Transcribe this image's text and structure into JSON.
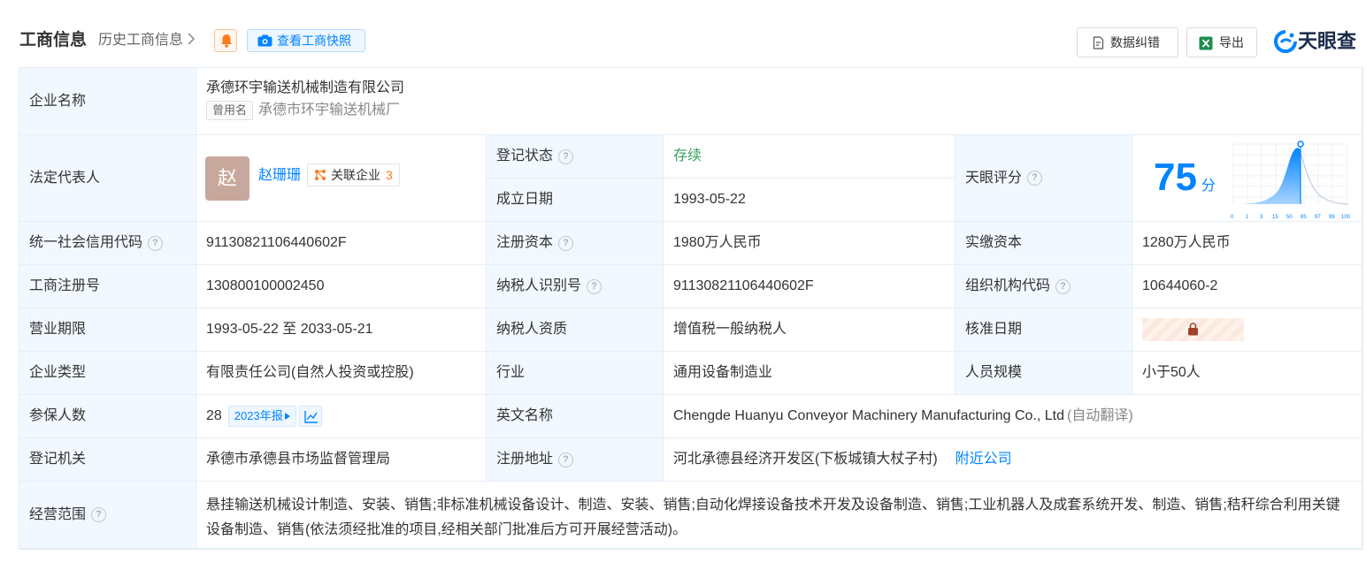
{
  "header": {
    "title": "工商信息",
    "history_link": "历史工商信息",
    "snapshot_button": "查看工商快照",
    "correct_button": "数据纠错",
    "export_button": "导出",
    "brand": "天眼查"
  },
  "company": {
    "name_label": "企业名称",
    "name": "承德环宇输送机械制造有限公司",
    "alias_tag": "曾用名",
    "alias": "承德市环宇输送机械厂",
    "legal_rep_label": "法定代表人",
    "legal_rep_avatar": "赵",
    "legal_rep_name": "赵珊珊",
    "related_label": "关联企业",
    "related_count": "3",
    "reg_status_label": "登记状态",
    "reg_status": "存续",
    "founded_label": "成立日期",
    "founded": "1993-05-22",
    "score_label": "天眼评分",
    "score": "75",
    "score_unit": "分",
    "score_ticks": [
      "0",
      "1",
      "3",
      "15",
      "50",
      "85",
      "97",
      "99",
      "100"
    ],
    "credit_code_label": "统一社会信用代码",
    "credit_code": "91130821106440602F",
    "reg_capital_label": "注册资本",
    "reg_capital": "1980万人民币",
    "paid_capital_label": "实缴资本",
    "paid_capital": "1280万人民币",
    "reg_no_label": "工商注册号",
    "reg_no": "130800100002450",
    "taxpayer_id_label": "纳税人识别号",
    "taxpayer_id": "91130821106440602F",
    "org_code_label": "组织机构代码",
    "org_code": "10644060-2",
    "term_label": "营业期限",
    "term": "1993-05-22 至 2033-05-21",
    "taxpayer_qual_label": "纳税人资质",
    "taxpayer_qual": "增值税一般纳税人",
    "approve_date_label": "核准日期",
    "type_label": "企业类型",
    "type": "有限责任公司(自然人投资或控股)",
    "industry_label": "行业",
    "industry": "通用设备制造业",
    "staff_label": "人员规模",
    "staff": "小于50人",
    "insured_label": "参保人数",
    "insured": "28",
    "report_tag": "2023年报",
    "english_label": "英文名称",
    "english": "Chengde Huanyu Conveyor Machinery Manufacturing Co., Ltd",
    "auto_translate": "(自动翻译)",
    "authority_label": "登记机关",
    "authority": "承德市承德县市场监督管理局",
    "address_label": "注册地址",
    "address": "河北承德县经济开发区(下板城镇大杖子村)",
    "nearby_link": "附近公司",
    "scope_label": "经营范围",
    "scope": "悬挂输送机械设计制造、安装、销售;非标准机械设备设计、制造、安装、销售;自动化焊接设备技术开发及设备制造、销售;工业机器人及成套系统开发、制造、销售;秸秆综合利用关键设备制造、销售(依法须经批准的项目,经相关部门批准后方可开展经营活动)。"
  },
  "colors": {
    "link": "#0084ff",
    "label_bg": "#f2f8ff",
    "status": "#3ba05e",
    "border": "#e4eef6",
    "count": "#ff7a1a"
  }
}
